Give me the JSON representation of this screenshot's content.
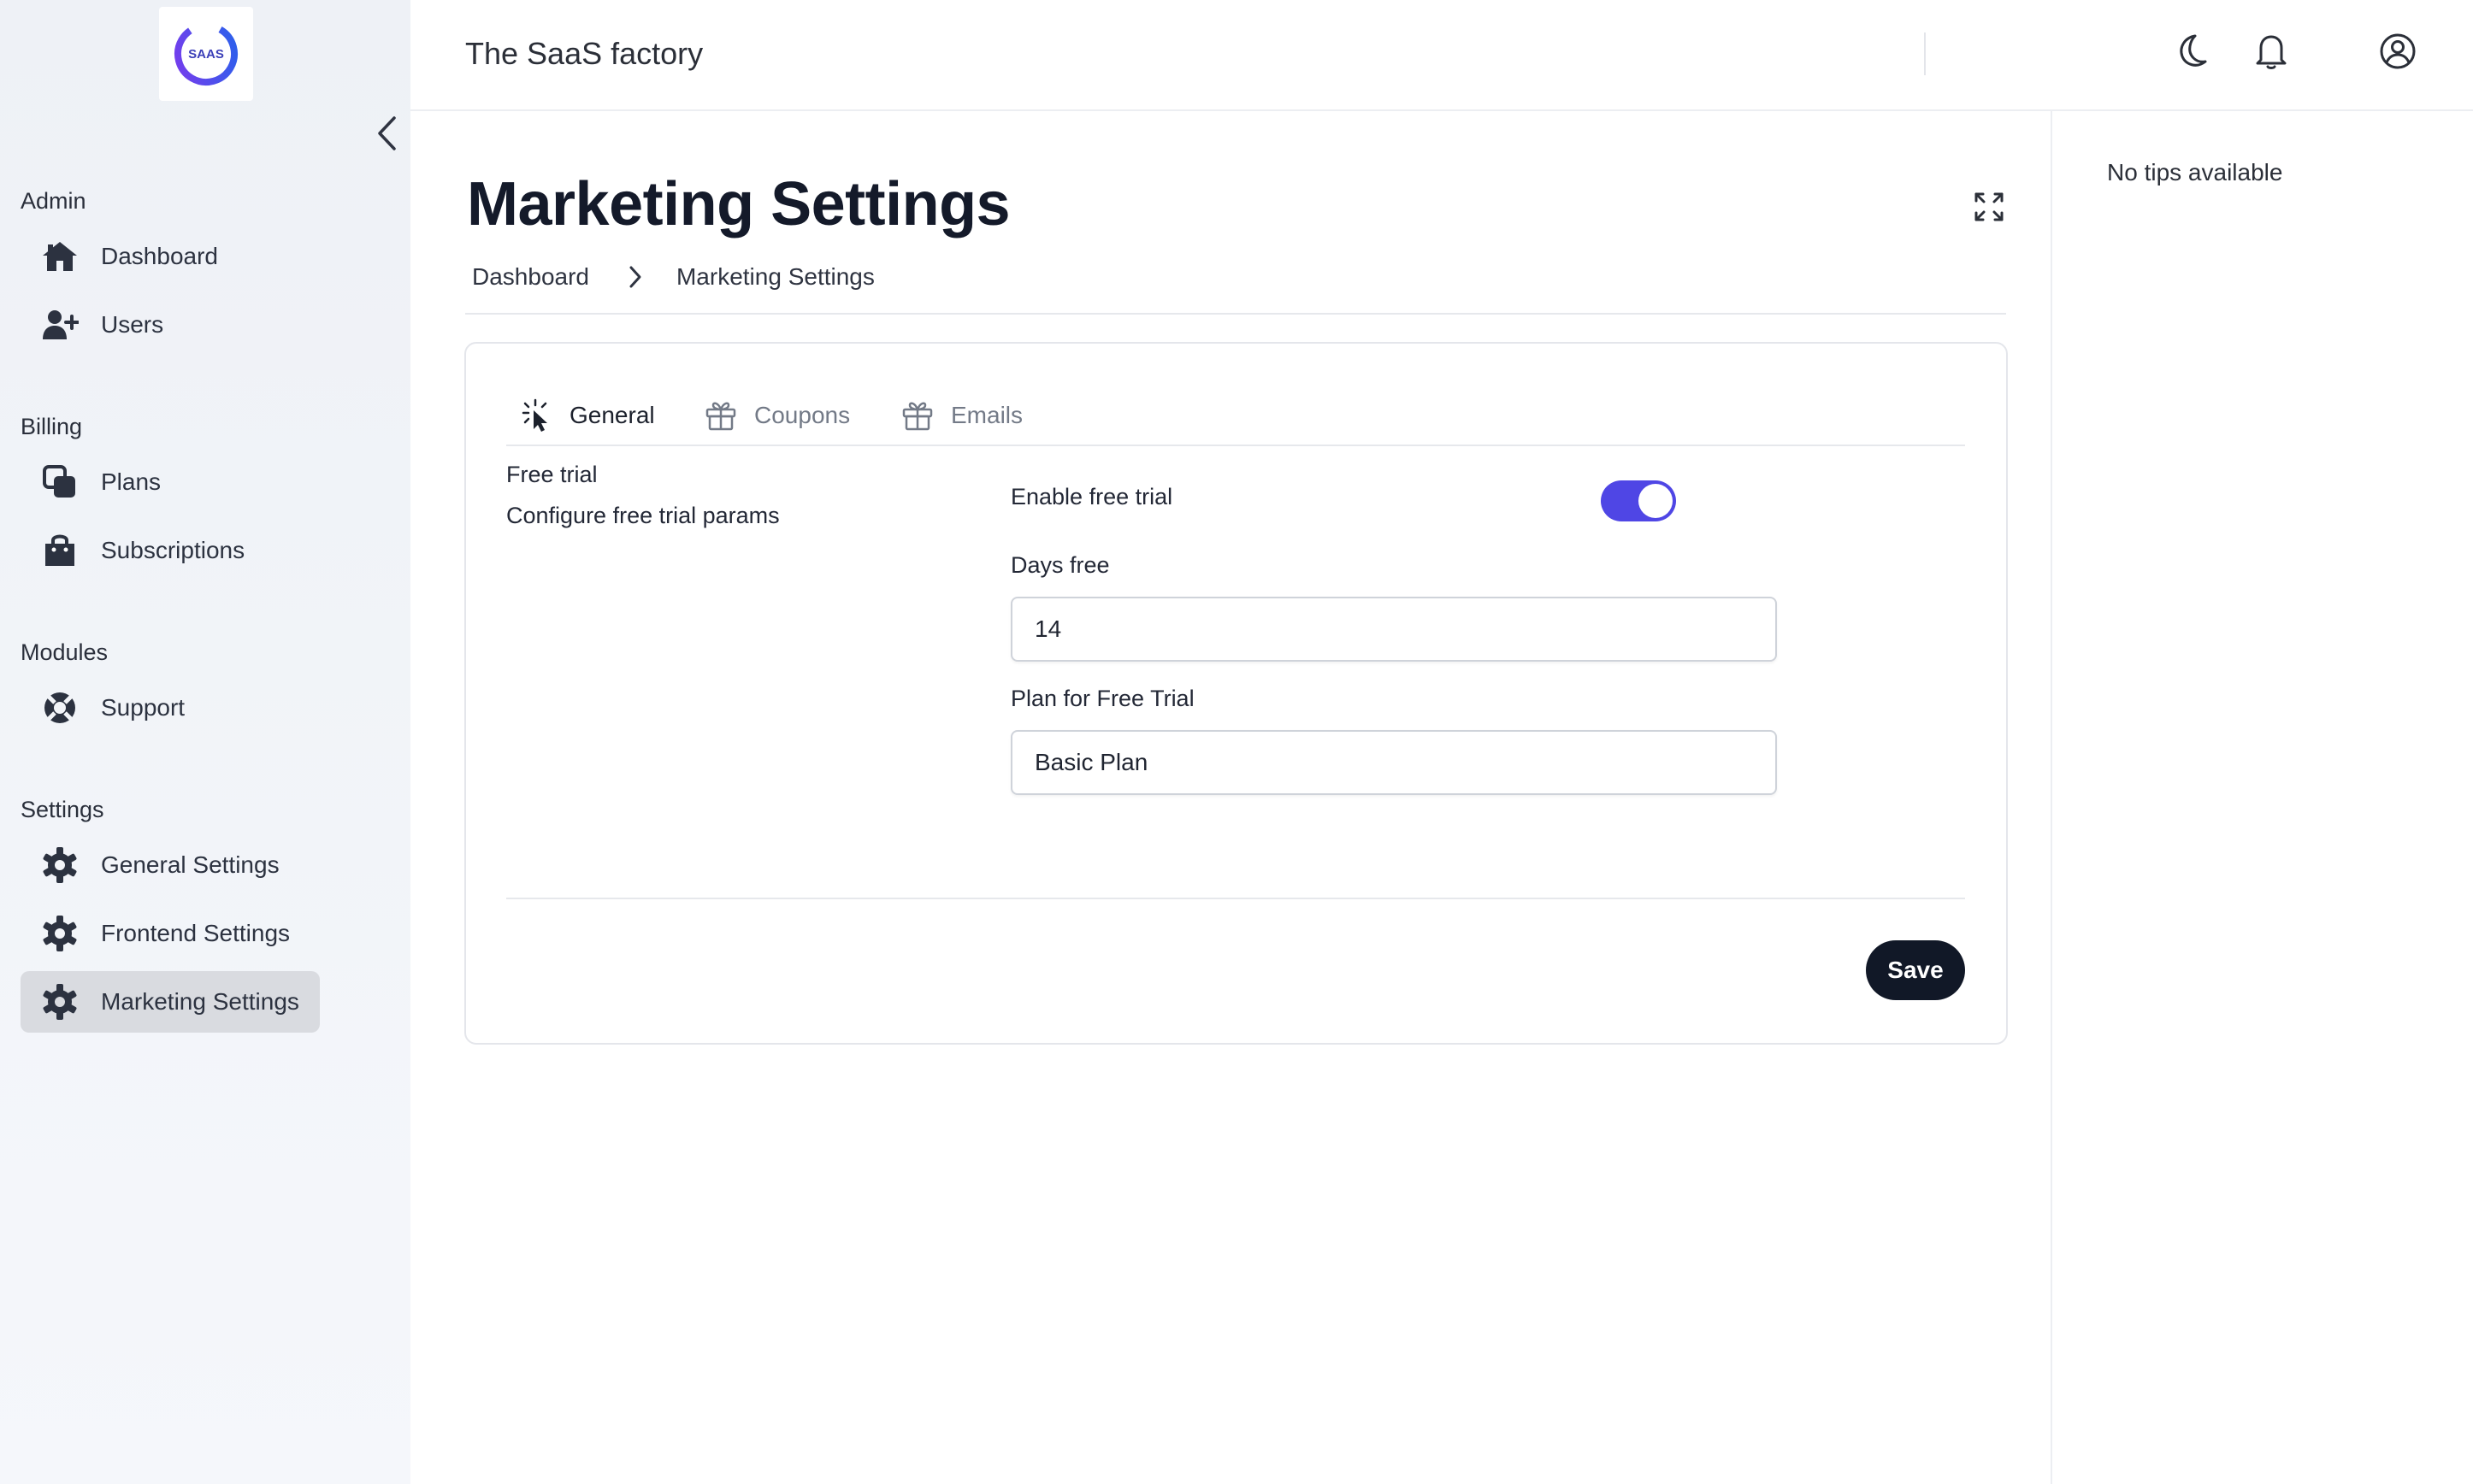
{
  "app": {
    "logo_text": "SAAS",
    "title": "The SaaS factory"
  },
  "sidebar": {
    "sections": [
      {
        "label": "Admin",
        "items": [
          {
            "label": "Dashboard",
            "icon": "house-icon"
          },
          {
            "label": "Users",
            "icon": "user-plus-icon"
          }
        ]
      },
      {
        "label": "Billing",
        "items": [
          {
            "label": "Plans",
            "icon": "copy-icon"
          },
          {
            "label": "Subscriptions",
            "icon": "shopping-bag-icon"
          }
        ]
      },
      {
        "label": "Modules",
        "items": [
          {
            "label": "Support",
            "icon": "life-ring-icon"
          }
        ]
      },
      {
        "label": "Settings",
        "items": [
          {
            "label": "General Settings",
            "icon": "gear-icon"
          },
          {
            "label": "Frontend Settings",
            "icon": "gear-icon"
          },
          {
            "label": "Marketing Settings",
            "icon": "gear-icon",
            "active": true
          }
        ]
      }
    ]
  },
  "page": {
    "title": "Marketing Settings",
    "breadcrumb": [
      "Dashboard",
      "Marketing Settings"
    ]
  },
  "tabs": [
    {
      "label": "General",
      "icon": "sparkle-cursor-icon",
      "active": true
    },
    {
      "label": "Coupons",
      "icon": "gift-icon"
    },
    {
      "label": "Emails",
      "icon": "gift-icon"
    }
  ],
  "form": {
    "section_title": "Free trial",
    "section_desc": "Configure free trial params",
    "enable_label": "Enable free trial",
    "enable_value": true,
    "days_label": "Days free",
    "days_value": "14",
    "plan_label": "Plan for Free Trial",
    "plan_value": "Basic Plan",
    "save_label": "Save"
  },
  "tips": {
    "text": "No tips available"
  },
  "colors": {
    "accent": "#4f46e5",
    "primary_button": "#111827",
    "logo_ring_start": "#7c3aed",
    "logo_ring_end": "#2563eb"
  }
}
